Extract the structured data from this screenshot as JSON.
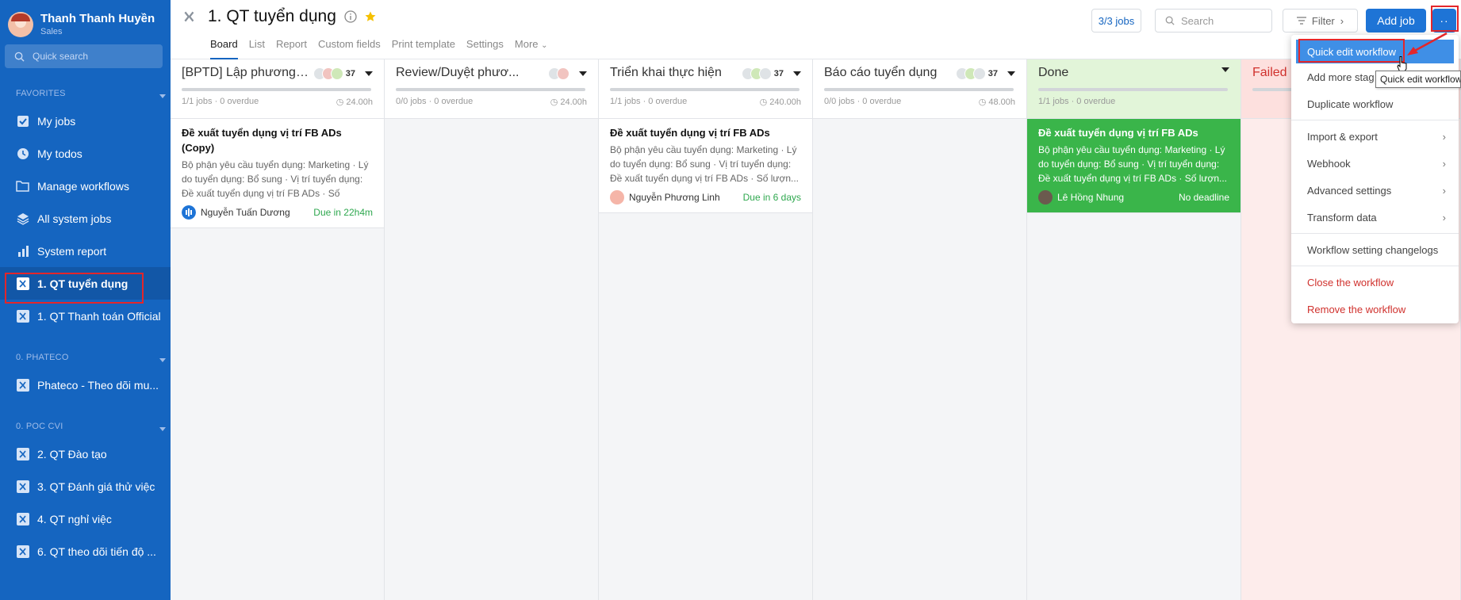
{
  "sidebar": {
    "user": {
      "name": "Thanh Thanh Huyền",
      "role": "Sales"
    },
    "quick_search_placeholder": "Quick search",
    "favorites_label": "FAVORITES",
    "favorites": [
      {
        "label": "My jobs",
        "icon": "check-square-icon"
      },
      {
        "label": "My todos",
        "icon": "clock-icon"
      },
      {
        "label": "Manage workflows",
        "icon": "folder-icon"
      },
      {
        "label": "All system jobs",
        "icon": "layers-icon"
      },
      {
        "label": "System report",
        "icon": "bar-chart-icon"
      },
      {
        "label": "1. QT tuyển dụng",
        "icon": "workflow-icon"
      },
      {
        "label": "1. QT Thanh toán Official",
        "icon": "workflow-icon"
      }
    ],
    "group1_label": "0. PHATECO",
    "group1": [
      {
        "label": "Phateco - Theo dõi mu...",
        "icon": "workflow-icon"
      }
    ],
    "group2_label": "0. POC CVI",
    "group2": [
      {
        "label": "2. QT Đào tạo",
        "icon": "workflow-icon"
      },
      {
        "label": "3. QT Đánh giá thử việc",
        "icon": "workflow-icon"
      },
      {
        "label": "4. QT nghỉ việc",
        "icon": "workflow-icon"
      },
      {
        "label": "6. QT theo dõi tiến độ ...",
        "icon": "workflow-icon"
      }
    ]
  },
  "header": {
    "title": "1. QT tuyển dụng",
    "tabs": [
      "Board",
      "List",
      "Report",
      "Custom fields",
      "Print template",
      "Settings",
      "More"
    ],
    "jobs_count": "3/3 jobs",
    "search_placeholder": "Search",
    "filter_label": "Filter",
    "add_job_label": "Add job",
    "more_label": "··"
  },
  "columns": [
    {
      "name": "[BPTD] Lập phương ...",
      "count": "37",
      "meta": "1/1 jobs · 0 overdue",
      "hours": "24.00h",
      "card": {
        "title": "Đề xuất tuyển dụng vị trí FB ADs (Copy)",
        "desc": "Bộ phận yêu cầu tuyển dụng: Marketing · Lý do tuyển dụng: Bổ sung · Vị trí tuyển dụng: Đề xuất tuyển dụng vị trí FB ADs · Số lượng...",
        "person": "Nguyễn Tuấn Dương",
        "due": "Due in 22h4m"
      }
    },
    {
      "name": "Review/Duyệt phươ...",
      "count": "",
      "meta": "0/0 jobs · 0 overdue",
      "hours": "24.00h"
    },
    {
      "name": "Triển khai thực hiện",
      "count": "37",
      "meta": "1/1 jobs · 0 overdue",
      "hours": "240.00h",
      "card": {
        "title": "Đề xuất tuyển dụng vị trí FB ADs",
        "desc": "Bộ phận yêu cầu tuyển dụng: Marketing · Lý do tuyển dụng: Bổ sung · Vị trí tuyển dụng: Đề xuất tuyển dụng vị trí FB ADs · Số lượn...",
        "person": "Nguyễn Phương Linh",
        "due": "Due in 6 days"
      }
    },
    {
      "name": "Báo cáo tuyển dụng",
      "count": "37",
      "meta": "0/0 jobs · 0 overdue",
      "hours": "48.00h"
    },
    {
      "name": "Done",
      "count": "",
      "meta": "1/1 jobs · 0 overdue",
      "hours": "",
      "card": {
        "title": "Đề xuất tuyển dụng vị trí FB ADs",
        "desc": "Bộ phận yêu cầu tuyển dụng: Marketing · Lý do tuyển dụng: Bổ sung · Vị trí tuyển dụng: Đề xuất tuyển dụng vị trí FB ADs · Số lượn...",
        "person": "Lê Hồng Nhung",
        "due": "No deadline"
      }
    },
    {
      "name": "Failed",
      "count": "",
      "meta": "",
      "hours": ""
    }
  ],
  "menu": {
    "items": [
      "Quick edit workflow",
      "Add more stag",
      "Duplicate workflow",
      "Import & export",
      "Webhook",
      "Advanced settings",
      "Transform data",
      "Workflow setting changelogs",
      "Close the workflow",
      "Remove the workflow"
    ],
    "tooltip": "Quick edit workflow"
  },
  "colors": {
    "sidebar": "#1565c0",
    "accent": "#1e74d6",
    "done": "#3ab54a",
    "danger": "#d0312d",
    "highlight": "#e4262a"
  }
}
